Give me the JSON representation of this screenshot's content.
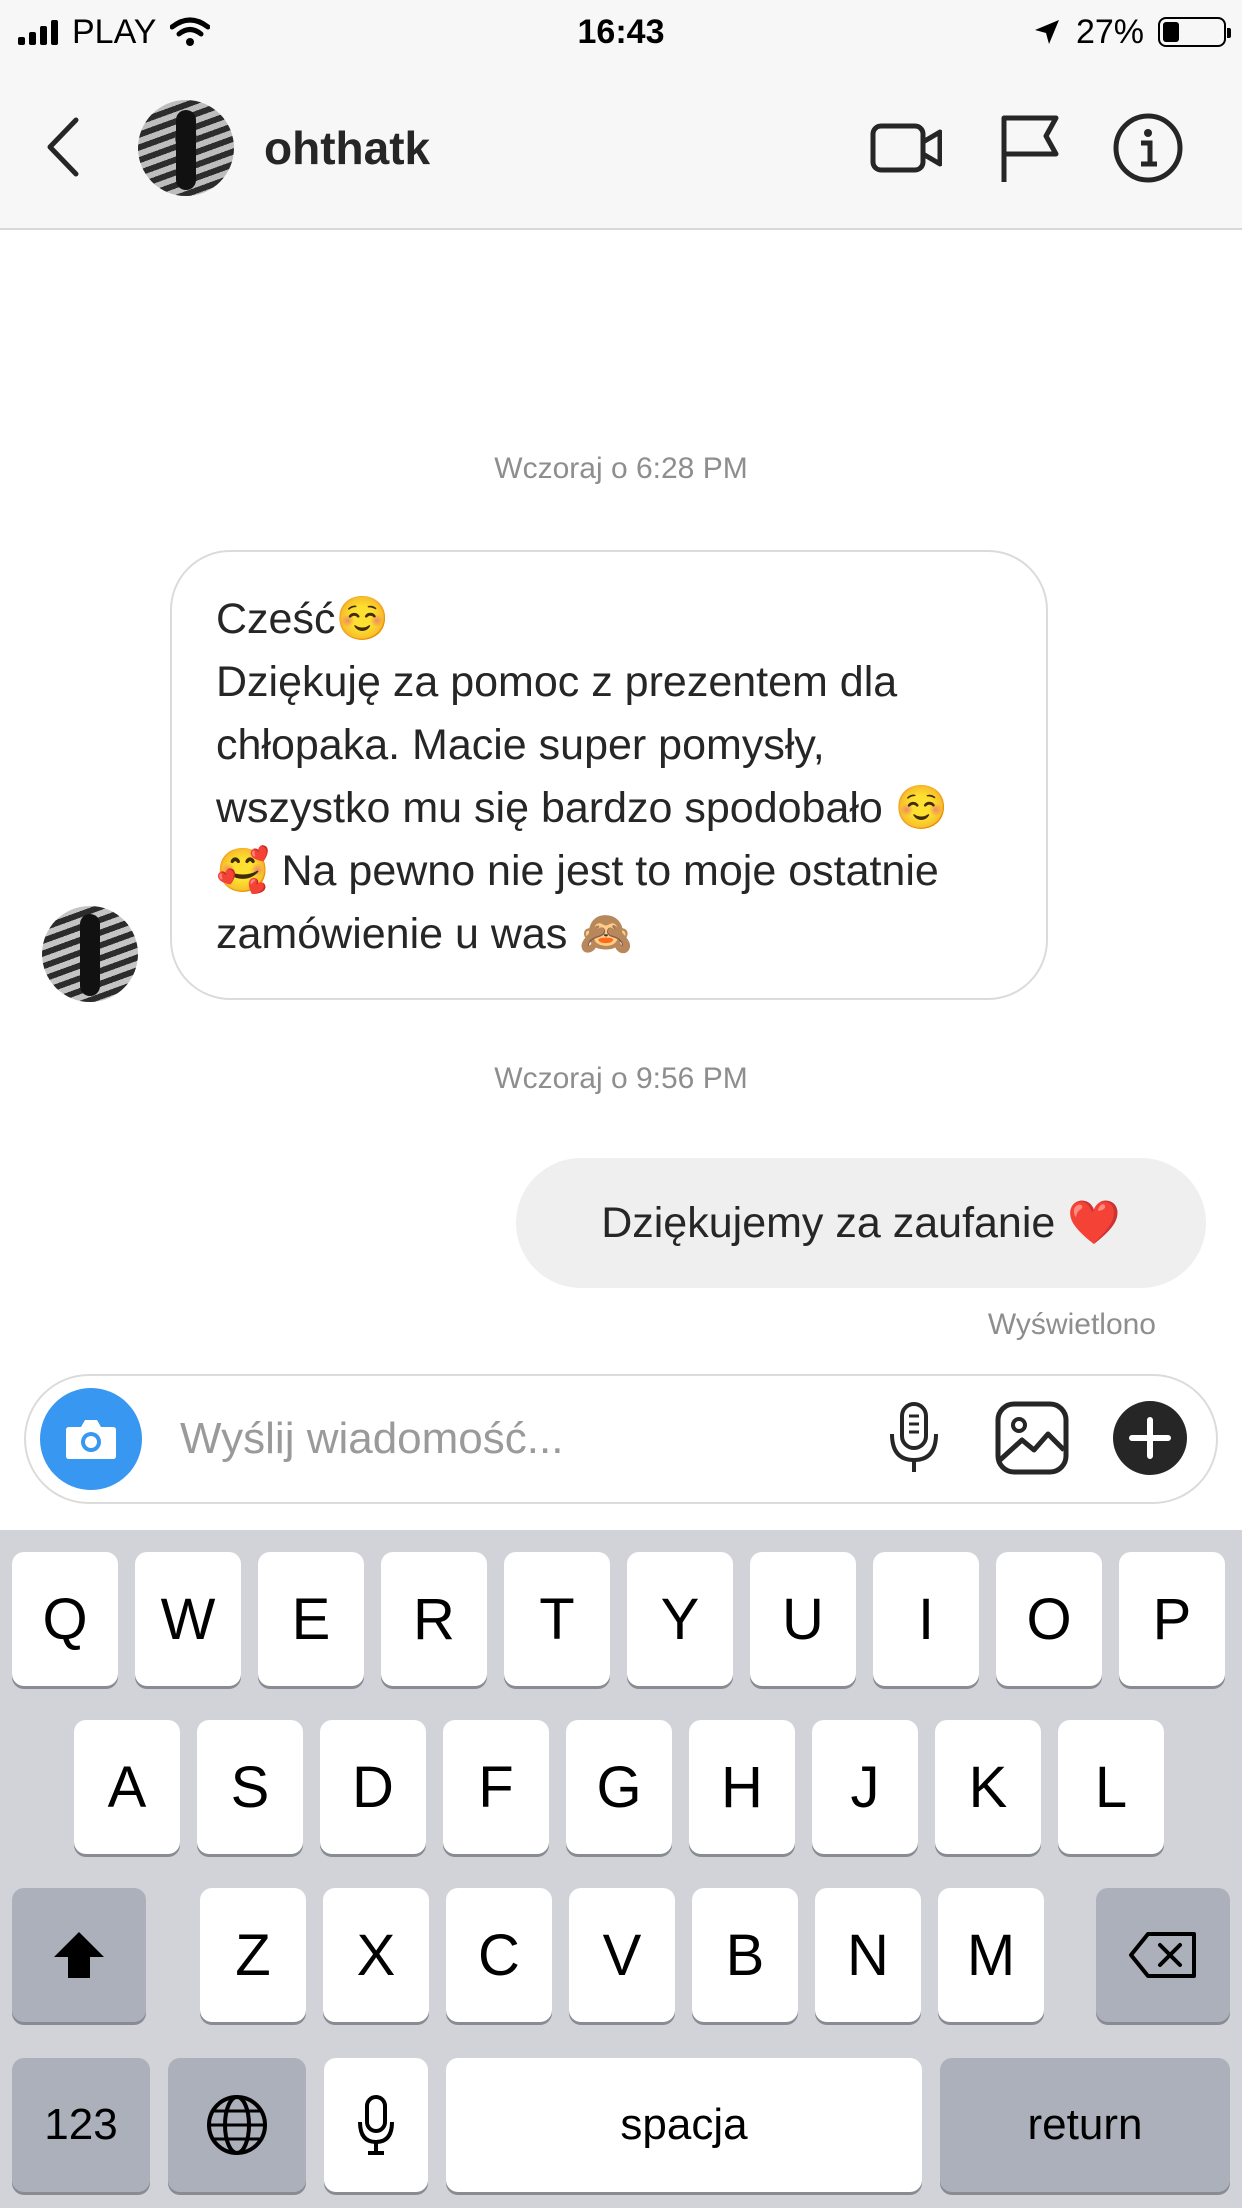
{
  "status_bar": {
    "carrier": "PLAY",
    "time": "16:43",
    "battery_percent": "27%",
    "battery_level": 0.27
  },
  "header": {
    "username": "ohthatk",
    "icons": [
      "back-chevron-icon",
      "video-call-icon",
      "flag-icon",
      "info-icon"
    ]
  },
  "chat": {
    "timestamp_1": "Wczoraj o 6:28 PM",
    "incoming_message": "Cześć☺️\nDziękuję za pomoc z prezentem dla chłopaka. Macie super pomysły, wszystko mu się bardzo spodobało ☺️ 🥰 Na pewno nie jest to moje ostatnie zamówienie u was 🙈",
    "timestamp_2": "Wczoraj o 9:56 PM",
    "outgoing_message": "Dziękujemy za zaufanie ❤️",
    "seen_label": "Wyświetlono"
  },
  "composer": {
    "placeholder": "Wyślij wiadomość...",
    "value": "",
    "icons": [
      "camera-icon",
      "microphone-icon",
      "gallery-icon",
      "plus-icon"
    ],
    "camera_color": "#3897f0"
  },
  "keyboard": {
    "row1": [
      "Q",
      "W",
      "E",
      "R",
      "T",
      "Y",
      "U",
      "I",
      "O",
      "P"
    ],
    "row2": [
      "A",
      "S",
      "D",
      "F",
      "G",
      "H",
      "J",
      "K",
      "L"
    ],
    "row3": [
      "Z",
      "X",
      "C",
      "V",
      "B",
      "N",
      "M"
    ],
    "numbers_label": "123",
    "space_label": "spacja",
    "return_label": "return",
    "icons": [
      "shift-icon",
      "backspace-icon",
      "globe-icon",
      "dictation-mic-icon"
    ]
  }
}
